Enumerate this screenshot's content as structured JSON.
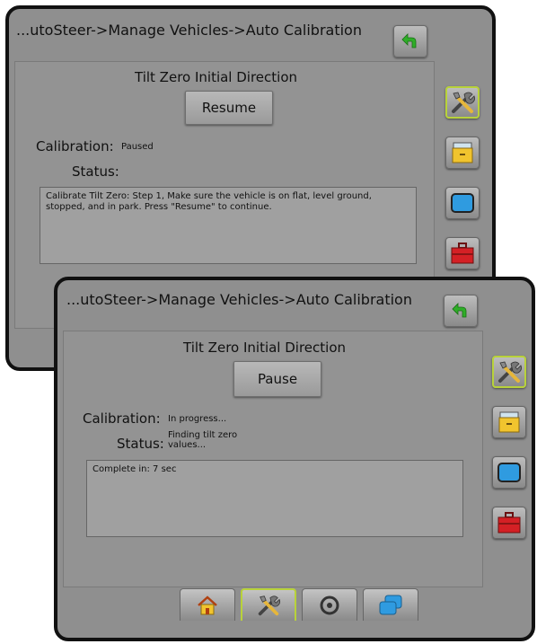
{
  "window_back": {
    "breadcrumb": "...utoSteer->Manage Vehicles->Auto Calibration",
    "section_title": "Tilt Zero Initial Direction",
    "action_label": "Resume",
    "calibration_label": "Calibration:",
    "calibration_value": "Paused",
    "status_label": "Status:",
    "message": "Calibrate Tilt Zero: Step 1, Make sure the vehicle is on flat, level ground, stopped, and in park. Press \"Resume\" to continue."
  },
  "window_front": {
    "breadcrumb": "...utoSteer->Manage Vehicles->Auto Calibration",
    "section_title": "Tilt Zero Initial Direction",
    "action_label": "Pause",
    "calibration_label": "Calibration:",
    "calibration_value": "In progress...",
    "status_label": "Status:",
    "status_value": "Finding tilt zero values...",
    "message": "Complete in: 7 sec"
  },
  "side_icons": [
    "tools-icon",
    "file-cabinet-icon",
    "display-icon",
    "toolbox-icon"
  ],
  "bottom_tabs": [
    "home-icon",
    "tools-icon",
    "steering-wheel-icon",
    "screens-icon"
  ],
  "colors": {
    "panel_bg": "#8f8f8f",
    "active_border": "#b8d23a",
    "back_arrow": "#2fae28",
    "cabinet_yellow": "#f1c42e",
    "display_blue": "#2f9be0",
    "toolbox_red": "#d42025"
  }
}
